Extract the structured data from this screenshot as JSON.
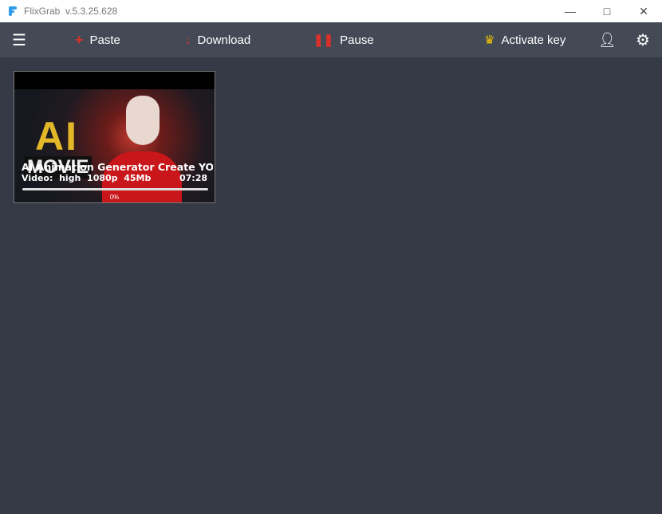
{
  "app": {
    "title": "FlixGrab",
    "version": "v.5.3.25.628"
  },
  "toolbar": {
    "paste": "Paste",
    "download": "Download",
    "pause": "Pause",
    "activate": "Activate key"
  },
  "items": [
    {
      "title": "AI Animation Generator Create YOU",
      "thumb_text_1": "AI",
      "thumb_text_2": "MOVIE",
      "type": "Video:",
      "quality": "high",
      "resolution": "1080p",
      "size": "45Mb",
      "duration": "07:28",
      "progress": "0%"
    }
  ],
  "colors": {
    "accent": "#d9302a",
    "crown": "#f2c200",
    "toolbar": "#434a56",
    "background": "#353a46"
  }
}
